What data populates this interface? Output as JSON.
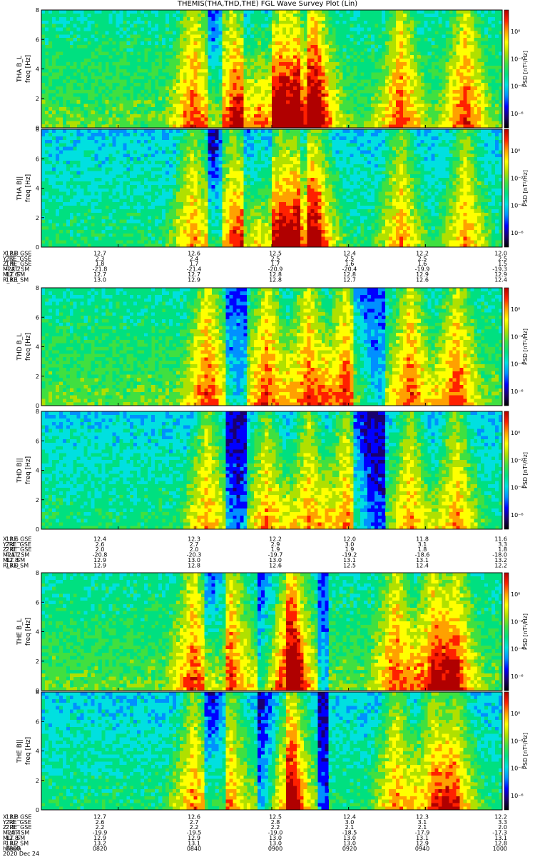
{
  "title": "THEMIS(THA,THD,THE) FGL Wave Survey Plot (Lin)",
  "colors": {
    "spectrum": [
      "#000000",
      "#1a006e",
      "#0000ff",
      "#0090ff",
      "#00e0e0",
      "#00e080",
      "#40e040",
      "#b0e000",
      "#ffff00",
      "#ffa000",
      "#ff2000",
      "#b00000"
    ]
  },
  "chart_data": {
    "type": "heatmap",
    "date": "2020 Dec 24",
    "x_label": "hhmm",
    "x_tick_labels": [
      "0800",
      "0820",
      "0840",
      "0900",
      "0920",
      "0940",
      "1000"
    ],
    "colorbar_label": "PSD [nT²/Hz]",
    "colorbar_tick_labels": [
      "10⁰",
      "10⁻²",
      "10⁻⁴",
      "10⁻⁶"
    ],
    "ylim": [
      0,
      8
    ],
    "y_tick_labels": [
      "0",
      "2",
      "4",
      "6",
      "8"
    ],
    "orbit_labels": [
      "X_RE_GSE",
      "Y_RE_GSE",
      "Z_RE_GSE",
      "MLAT_SM",
      "MLT_SM",
      "R_RE_SM"
    ],
    "panels": [
      {
        "name": "THA B_L",
        "ylabel": "THA B_L",
        "yunits": "freq [Hz]",
        "probe": "THA"
      },
      {
        "name": "THA B||",
        "ylabel": "THA B||",
        "yunits": "freq [Hz]",
        "probe": "THA"
      },
      {
        "name": "THD B_L",
        "ylabel": "THD B_L",
        "yunits": "freq [Hz]",
        "probe": "THD"
      },
      {
        "name": "THD B||",
        "ylabel": "THD B||",
        "yunits": "freq [Hz]",
        "probe": "THD"
      },
      {
        "name": "THE B_L",
        "ylabel": "THE B_L",
        "yunits": "freq [Hz]",
        "probe": "THE"
      },
      {
        "name": "THE B||",
        "ylabel": "THE B||",
        "yunits": "freq [Hz]",
        "probe": "THE"
      }
    ],
    "orbit_tables": [
      {
        "probe": "THA",
        "rows": [
          [
            "12.8",
            "12.7",
            "12.6",
            "12.5",
            "12.4",
            "12.2",
            "12.0"
          ],
          [
            "2.2",
            "2.3",
            "2.4",
            "2.5",
            "2.5",
            "2.5",
            "2.5"
          ],
          [
            "1.9",
            "1.8",
            "1.7",
            "1.7",
            "1.6",
            "1.6",
            "1.5"
          ],
          [
            "-22.2",
            "-21.8",
            "-21.4",
            "-20.9",
            "-20.4",
            "-19.9",
            "-19.3"
          ],
          [
            "12.6",
            "12.7",
            "12.7",
            "12.8",
            "12.8",
            "12.9",
            "12.9"
          ],
          [
            "13.1",
            "13.0",
            "12.9",
            "12.8",
            "12.7",
            "12.6",
            "12.4"
          ]
        ]
      },
      {
        "probe": "THD",
        "rows": [
          [
            "12.6",
            "12.4",
            "12.3",
            "12.2",
            "12.0",
            "11.8",
            "11.6"
          ],
          [
            "2.4",
            "2.6",
            "2.7",
            "2.9",
            "3.0",
            "3.1",
            "3.3"
          ],
          [
            "2.0",
            "2.0",
            "2.0",
            "1.9",
            "1.9",
            "1.8",
            "1.8"
          ],
          [
            "-21.2",
            "-20.8",
            "-20.3",
            "-19.7",
            "-19.2",
            "-18.6",
            "-18.0"
          ],
          [
            "12.8",
            "12.9",
            "13.0",
            "13.0",
            "13.1",
            "13.1",
            "13.2"
          ],
          [
            "13.0",
            "12.9",
            "12.8",
            "12.6",
            "12.5",
            "12.4",
            "12.2"
          ]
        ]
      },
      {
        "probe": "THE",
        "rows": [
          [
            "12.8",
            "12.7",
            "12.6",
            "12.5",
            "12.4",
            "12.3",
            "12.2"
          ],
          [
            "2.4",
            "2.6",
            "2.7",
            "2.8",
            "3.0",
            "3.1",
            "3.3"
          ],
          [
            "2.3",
            "2.2",
            "2.2",
            "2.2",
            "2.1",
            "2.1",
            "2.0"
          ],
          [
            "-20.4",
            "-19.9",
            "-19.5",
            "-19.0",
            "-18.5",
            "-17.9",
            "-17.3"
          ],
          [
            "12.8",
            "12.9",
            "12.9",
            "13.0",
            "13.0",
            "13.1",
            "13.1"
          ],
          [
            "13.2",
            "13.2",
            "13.1",
            "13.0",
            "13.0",
            "12.9",
            "12.8"
          ]
        ]
      }
    ]
  }
}
